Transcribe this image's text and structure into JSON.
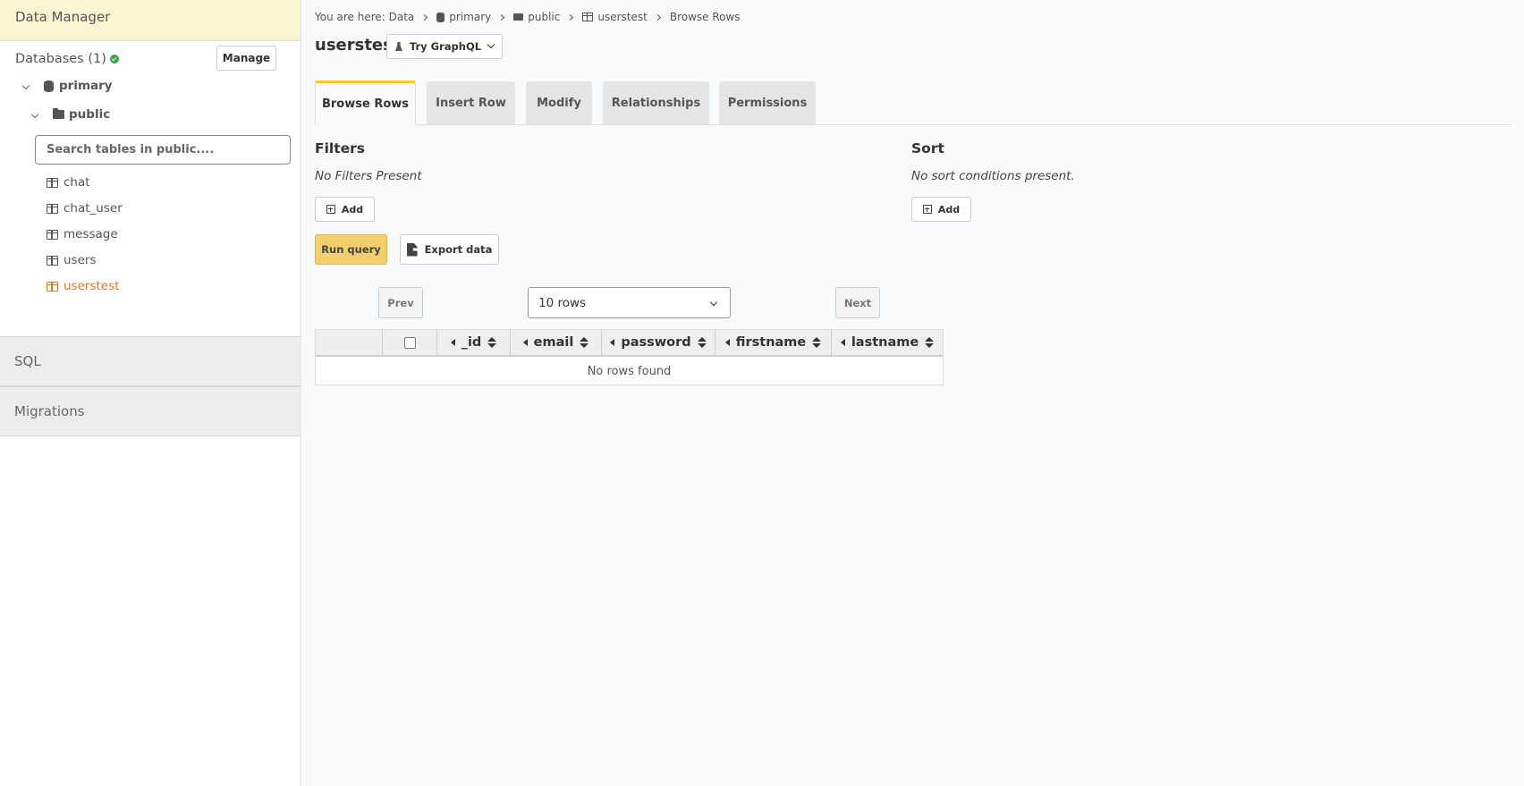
{
  "sidebar": {
    "title": "Data Manager",
    "databases_label": "Databases (1)",
    "manage_label": "Manage",
    "db_name": "primary",
    "schema_name": "public",
    "search_placeholder": "Search tables in public....",
    "tables": [
      "chat",
      "chat_user",
      "message",
      "users",
      "userstest"
    ],
    "active_table": "userstest",
    "sections": [
      "SQL",
      "Migrations"
    ]
  },
  "breadcrumb": {
    "prefix": "You are here: Data",
    "items": [
      "primary",
      "public",
      "userstest",
      "Browse Rows"
    ]
  },
  "header": {
    "title": "userstest",
    "graphql_label": "Try GraphQL"
  },
  "tabs": [
    "Browse Rows",
    "Insert Row",
    "Modify",
    "Relationships",
    "Permissions"
  ],
  "active_tab": "Browse Rows",
  "filters": {
    "title": "Filters",
    "empty": "No Filters Present",
    "add_label": "Add"
  },
  "sort": {
    "title": "Sort",
    "empty": "No sort conditions present.",
    "add_label": "Add"
  },
  "actions": {
    "run_label": "Run query",
    "export_label": "Export data"
  },
  "pagination": {
    "prev": "Prev",
    "next": "Next",
    "rows": "10 rows"
  },
  "grid": {
    "columns": [
      "_id",
      "email",
      "password",
      "firstname",
      "lastname"
    ],
    "empty": "No rows found"
  },
  "colors": {
    "accent": "#ffc627",
    "run_button": "#f2ce6d",
    "active_table": "#e0791a",
    "header_bg": "#fcf5d4",
    "status_ok": "#3aa546"
  }
}
